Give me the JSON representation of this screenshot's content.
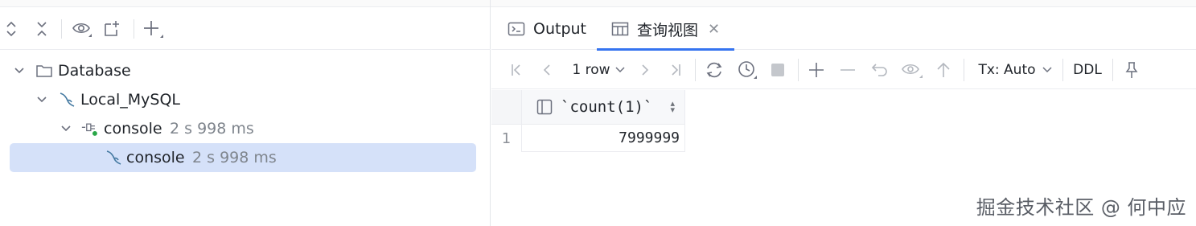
{
  "left_panel": {
    "toolbar": {
      "expand_icon": "expand-all-icon",
      "collapse_icon": "collapse-all-icon",
      "view_icon": "eye-icon",
      "new_tab_icon": "new-tab-icon",
      "add_icon": "plus-icon"
    },
    "tree": [
      {
        "label": "Database",
        "time": "",
        "icon": "folder-icon",
        "level": 0,
        "expanded": true
      },
      {
        "label": "Local_MySQL",
        "time": "",
        "icon": "mysql-dolphin-icon",
        "level": 1,
        "expanded": true
      },
      {
        "label": "console",
        "time": "2 s 998 ms",
        "icon": "session-icon",
        "level": 2,
        "expanded": true
      },
      {
        "label": "console",
        "time": "2 s 998 ms",
        "icon": "mysql-dolphin-icon",
        "level": 3,
        "selected": true
      }
    ]
  },
  "tabs": [
    {
      "label": "Output",
      "icon": "console-icon",
      "active": false
    },
    {
      "label": "查询视图",
      "icon": "table-icon",
      "active": true,
      "closable": true
    }
  ],
  "result_toolbar": {
    "row_count": "1 row",
    "transaction": "Tx: Auto",
    "ddl": "DDL"
  },
  "grid": {
    "columns": [
      "`count(1)`"
    ],
    "rows": [
      {
        "num": "1",
        "values": [
          "7999999"
        ]
      }
    ]
  },
  "watermark": "掘金技术社区 @ 何中应",
  "colors": {
    "accent": "#3574f0",
    "selection": "#d5e1f9",
    "mysql_blue": "#4479a1",
    "session_green": "#2aa748"
  }
}
